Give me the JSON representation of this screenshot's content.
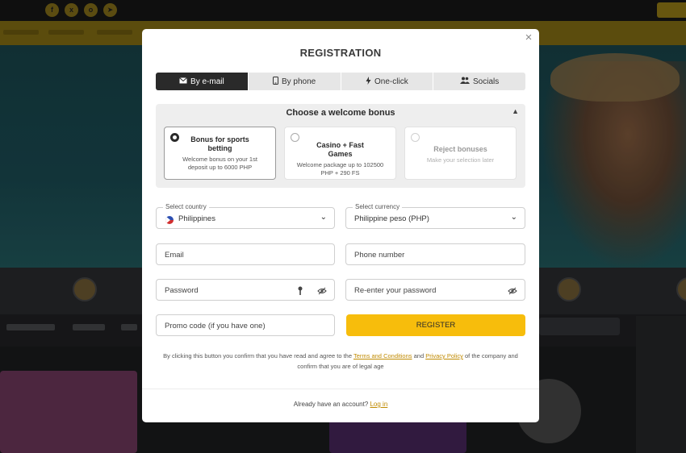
{
  "background": {
    "accent_color": "#f7bd0c"
  },
  "modal": {
    "title": "REGISTRATION",
    "close_label": "×",
    "tabs": [
      {
        "label": "By e-mail",
        "icon": "envelope-icon",
        "active": true
      },
      {
        "label": "By phone",
        "icon": "phone-icon",
        "active": false
      },
      {
        "label": "One-click",
        "icon": "lightning-icon",
        "active": false
      },
      {
        "label": "Socials",
        "icon": "users-icon",
        "active": false
      }
    ],
    "bonus": {
      "heading": "Choose a welcome bonus",
      "options": [
        {
          "title": "Bonus for sports betting",
          "desc": "Welcome bonus on your 1st deposit up to 6000 PHP",
          "selected": true,
          "disabled": false
        },
        {
          "title": "Casino + Fast Games",
          "desc": "Welcome package up to 102500 PHP + 290 FS",
          "selected": false,
          "disabled": false
        },
        {
          "title": "Reject bonuses",
          "desc": "Make your selection later",
          "selected": false,
          "disabled": true
        }
      ]
    },
    "fields": {
      "country_label": "Select country",
      "country_value": "Philippines",
      "currency_label": "Select currency",
      "currency_value": "Philippine peso (PHP)",
      "email_placeholder": "Email",
      "phone_placeholder": "Phone number",
      "password_placeholder": "Password",
      "repassword_placeholder": "Re-enter your password",
      "promo_placeholder": "Promo code (if you have one)"
    },
    "register_label": "REGISTER",
    "terms": {
      "prefix": "By clicking this button you confirm that you have read and agree to the ",
      "terms_link": "Terms and Conditions",
      "and": " and ",
      "privacy_link": "Privacy Policy",
      "suffix": " of the company and confirm that you are of legal age"
    },
    "login": {
      "prompt": "Already have an account? ",
      "link": "Log in"
    }
  }
}
